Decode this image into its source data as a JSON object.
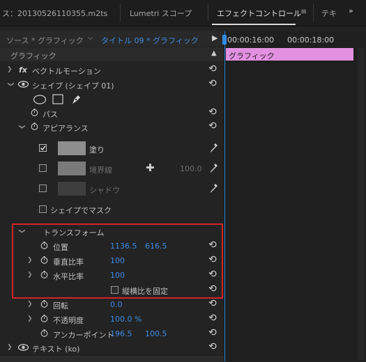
{
  "tabs": {
    "source_clip": "ス：20130526110355.m2ts",
    "lumetri": "Lumetri スコープ",
    "effect_controls": "エフェクトコントロール",
    "menu_glyph": "≡",
    "text_tab": "テキ"
  },
  "source_row": {
    "source": "ソース * グラフィック",
    "clip": "タイトル 09 * グラフィック"
  },
  "section": {
    "title": "グラフィック"
  },
  "timeline": {
    "tc1": "00:00:16:00",
    "tc2": "00:00:18:00",
    "clip_label": "グラフィック"
  },
  "effects": {
    "vector_motion": "ベクトルモーション",
    "fx": "fx",
    "shape_layer": "シェイプ (シェイプ 01)",
    "path": "パス",
    "appearance": "アピアランス",
    "fill": "塗り",
    "stroke": "境界線",
    "stroke_value": "100.0",
    "shadow": "シャドウ",
    "shape_mask": "シェイプでマスク",
    "transform": "トランスフォーム",
    "position": "位置",
    "position_x": "1136.5",
    "position_y": "616.5",
    "scale_height": "垂直比率",
    "scale_height_value": "100",
    "scale_width": "水平比率",
    "scale_width_value": "100",
    "uniform_scale": "縦横比を固定",
    "rotation": "回転",
    "rotation_value": "0.0",
    "opacity": "不透明度",
    "opacity_value": "100.0 %",
    "anchor": "アンカーポイント",
    "anchor_x": "196.5",
    "anchor_y": "100.5",
    "text_layer": "テキスト (ko)"
  },
  "colors": {
    "accent_blue": "#3d8be0",
    "clip_pink": "#e291e0",
    "highlight_red": "#d6232a"
  }
}
